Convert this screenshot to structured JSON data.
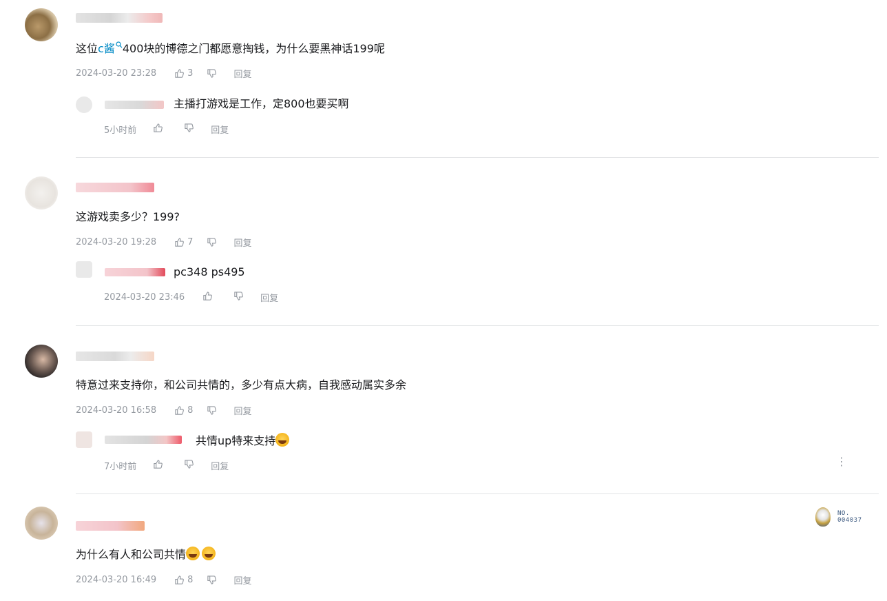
{
  "comments": [
    {
      "text_pre": "这位",
      "tag": "c酱",
      "tag_icon": "search-icon",
      "text_post": "400块的博德之门都愿意掏钱，为什么要黑神话199呢",
      "time": "2024-03-20 23:28",
      "likes": "3",
      "reply_label": "回复",
      "reply": {
        "text": "主播打游戏是工作，定800也要买啊",
        "time": "5小时前",
        "likes": "",
        "reply_label": "回复"
      }
    },
    {
      "text": "这游戏卖多少？199?",
      "time": "2024-03-20 19:28",
      "likes": "7",
      "reply_label": "回复",
      "reply": {
        "text": "pc348 ps495",
        "time": "2024-03-20 23:46",
        "likes": "",
        "reply_label": "回复"
      }
    },
    {
      "text": "特意过来支持你，和公司共情的，多少有点大病，自我感动属实多余",
      "time": "2024-03-20 16:58",
      "likes": "8",
      "reply_label": "回复",
      "reply": {
        "text": "共情up特来支持",
        "time": "7小时前",
        "likes": "",
        "reply_label": "回复"
      }
    },
    {
      "text": "为什么有人和公司共情",
      "time": "2024-03-20 16:49",
      "likes": "8",
      "reply_label": "回复"
    }
  ],
  "fan_badge": {
    "line1": "NO.",
    "line2": "004037"
  },
  "more_glyph": "⋮",
  "colors": {
    "accent": "#008ac5",
    "meta": "#9499a0",
    "text": "#18191c",
    "divider": "#e3e5e7"
  },
  "icons": {
    "like": "thumbs-up-icon",
    "dislike": "thumbs-down-icon",
    "emoji_grin": "grinning-emoji-icon",
    "emoji_laugh": "laughing-tears-emoji-icon"
  }
}
